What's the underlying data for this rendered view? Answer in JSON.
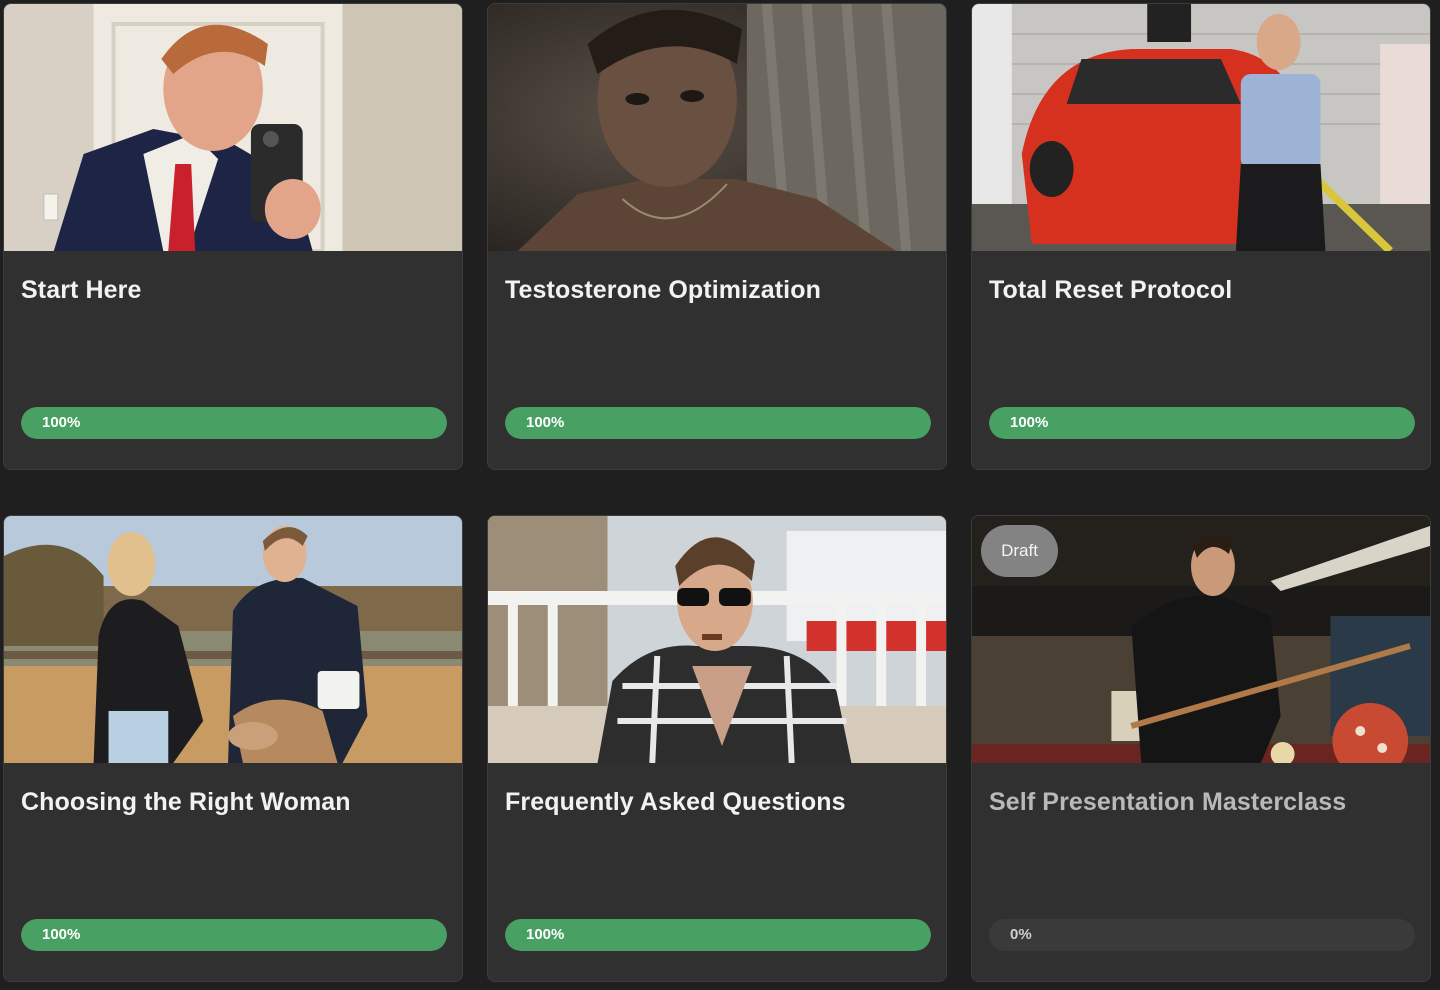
{
  "courses": [
    {
      "title": "Start Here",
      "progress_label": "100%",
      "progress": 1.0,
      "image": "man-in-suit-mirror-selfie"
    },
    {
      "title": "Testosterone Optimization",
      "progress_label": "100%",
      "progress": 1.0,
      "image": "shirtless-man-dark-shower"
    },
    {
      "title": "Total Reset Protocol",
      "progress_label": "100%",
      "progress": 1.0,
      "image": "man-sitting-on-red-sports-car"
    },
    {
      "title": "Choosing the Right Woman",
      "progress_label": "100%",
      "progress": 1.0,
      "image": "couple-feeding-deer"
    },
    {
      "title": "Frequently Asked Questions",
      "progress_label": "100%",
      "progress": 1.0,
      "image": "man-sunglasses-cigar-balcony"
    },
    {
      "title": "Self Presentation Masterclass",
      "progress_label": "0%",
      "progress": 0.0,
      "image": "man-playing-pool",
      "badge": "Draft"
    }
  ],
  "colors": {
    "page_background": "#1f1f1f",
    "card_background": "#303030",
    "progress_fill": "#48a063",
    "progress_track": "#3a3a3a",
    "badge_background": "#8c8c8c"
  }
}
